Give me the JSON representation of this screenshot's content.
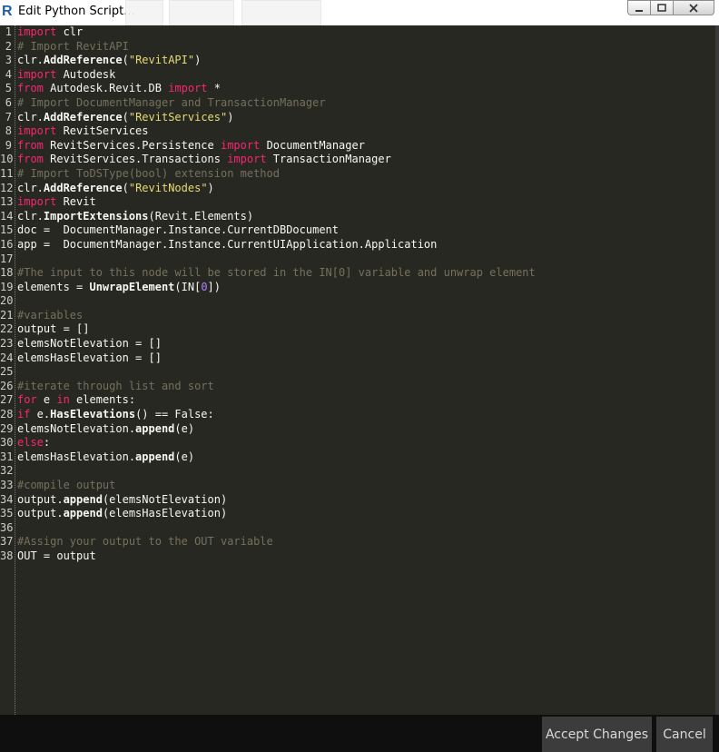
{
  "window": {
    "title": "Edit Python Script...",
    "app_icon": "revit-icon",
    "app_icon_letter": "R"
  },
  "editor": {
    "lines": [
      [
        [
          "kw",
          "import"
        ],
        [
          "code",
          " clr"
        ]
      ],
      [
        [
          "cm",
          "# Import RevitAPI"
        ]
      ],
      [
        [
          "code",
          "clr."
        ],
        [
          "fn",
          "AddReference"
        ],
        [
          "code",
          "("
        ],
        [
          "str",
          "\"RevitAPI\""
        ],
        [
          "code",
          ")"
        ]
      ],
      [
        [
          "kw",
          "import"
        ],
        [
          "code",
          " Autodesk"
        ]
      ],
      [
        [
          "kw",
          "from"
        ],
        [
          "code",
          " Autodesk.Revit.DB "
        ],
        [
          "kw",
          "import"
        ],
        [
          "code",
          " *"
        ]
      ],
      [
        [
          "cm",
          "# Import DocumentManager and TransactionManager"
        ]
      ],
      [
        [
          "code",
          "clr."
        ],
        [
          "fn",
          "AddReference"
        ],
        [
          "code",
          "("
        ],
        [
          "str",
          "\"RevitServices\""
        ],
        [
          "code",
          ")"
        ]
      ],
      [
        [
          "kw",
          "import"
        ],
        [
          "code",
          " RevitServices"
        ]
      ],
      [
        [
          "kw",
          "from"
        ],
        [
          "code",
          " RevitServices.Persistence "
        ],
        [
          "kw",
          "import"
        ],
        [
          "code",
          " DocumentManager"
        ]
      ],
      [
        [
          "kw",
          "from"
        ],
        [
          "code",
          " RevitServices.Transactions "
        ],
        [
          "kw",
          "import"
        ],
        [
          "code",
          " TransactionManager"
        ]
      ],
      [
        [
          "cm",
          "# Import ToDSType(bool) extension method"
        ]
      ],
      [
        [
          "code",
          "clr."
        ],
        [
          "fn",
          "AddReference"
        ],
        [
          "code",
          "("
        ],
        [
          "str",
          "\"RevitNodes\""
        ],
        [
          "code",
          ")"
        ]
      ],
      [
        [
          "kw",
          "import"
        ],
        [
          "code",
          " Revit"
        ]
      ],
      [
        [
          "code",
          "clr."
        ],
        [
          "fn",
          "ImportExtensions"
        ],
        [
          "code",
          "(Revit.Elements)"
        ]
      ],
      [
        [
          "code",
          "doc =  DocumentManager.Instance.CurrentDBDocument"
        ]
      ],
      [
        [
          "code",
          "app =  DocumentManager.Instance.CurrentUIApplication.Application"
        ]
      ],
      [],
      [
        [
          "cm",
          "#The input to this node will be stored in the IN[0] variable and unwrap element"
        ]
      ],
      [
        [
          "code",
          "elements = "
        ],
        [
          "fn",
          "UnwrapElement"
        ],
        [
          "code",
          "(IN["
        ],
        [
          "num",
          "0"
        ],
        [
          "code",
          "])"
        ]
      ],
      [],
      [
        [
          "cm",
          "#variables"
        ]
      ],
      [
        [
          "code",
          "output = []"
        ]
      ],
      [
        [
          "code",
          "elemsNotElevation = []"
        ]
      ],
      [
        [
          "code",
          "elemsHasElevation = []"
        ]
      ],
      [],
      [
        [
          "cm",
          "#iterate through list and sort"
        ]
      ],
      [
        [
          "kw",
          "for"
        ],
        [
          "code",
          " e "
        ],
        [
          "kw",
          "in"
        ],
        [
          "code",
          " elements:"
        ]
      ],
      [
        [
          "kw",
          "if"
        ],
        [
          "code",
          " e."
        ],
        [
          "fn",
          "HasElevations"
        ],
        [
          "code",
          "() == False:"
        ]
      ],
      [
        [
          "code",
          "elemsNotElevation."
        ],
        [
          "fn",
          "append"
        ],
        [
          "code",
          "(e)"
        ]
      ],
      [
        [
          "kw",
          "else"
        ],
        [
          "code",
          ":"
        ]
      ],
      [
        [
          "code",
          "elemsHasElevation."
        ],
        [
          "fn",
          "append"
        ],
        [
          "code",
          "(e)"
        ]
      ],
      [],
      [
        [
          "cm",
          "#compile output"
        ]
      ],
      [
        [
          "code",
          "output."
        ],
        [
          "fn",
          "append"
        ],
        [
          "code",
          "(elemsNotElevation)"
        ]
      ],
      [
        [
          "code",
          "output."
        ],
        [
          "fn",
          "append"
        ],
        [
          "code",
          "(elemsHasElevation)"
        ]
      ],
      [],
      [
        [
          "cm",
          "#Assign your output to the OUT variable"
        ]
      ],
      [
        [
          "code",
          "OUT = output"
        ]
      ]
    ]
  },
  "footer": {
    "accept_label": "Accept Changes",
    "cancel_label": "Cancel"
  },
  "colors": {
    "editor_bg": "#272822",
    "keyword": "#f92672",
    "string": "#e6db74",
    "comment": "#75715e",
    "number": "#ae81ff"
  }
}
